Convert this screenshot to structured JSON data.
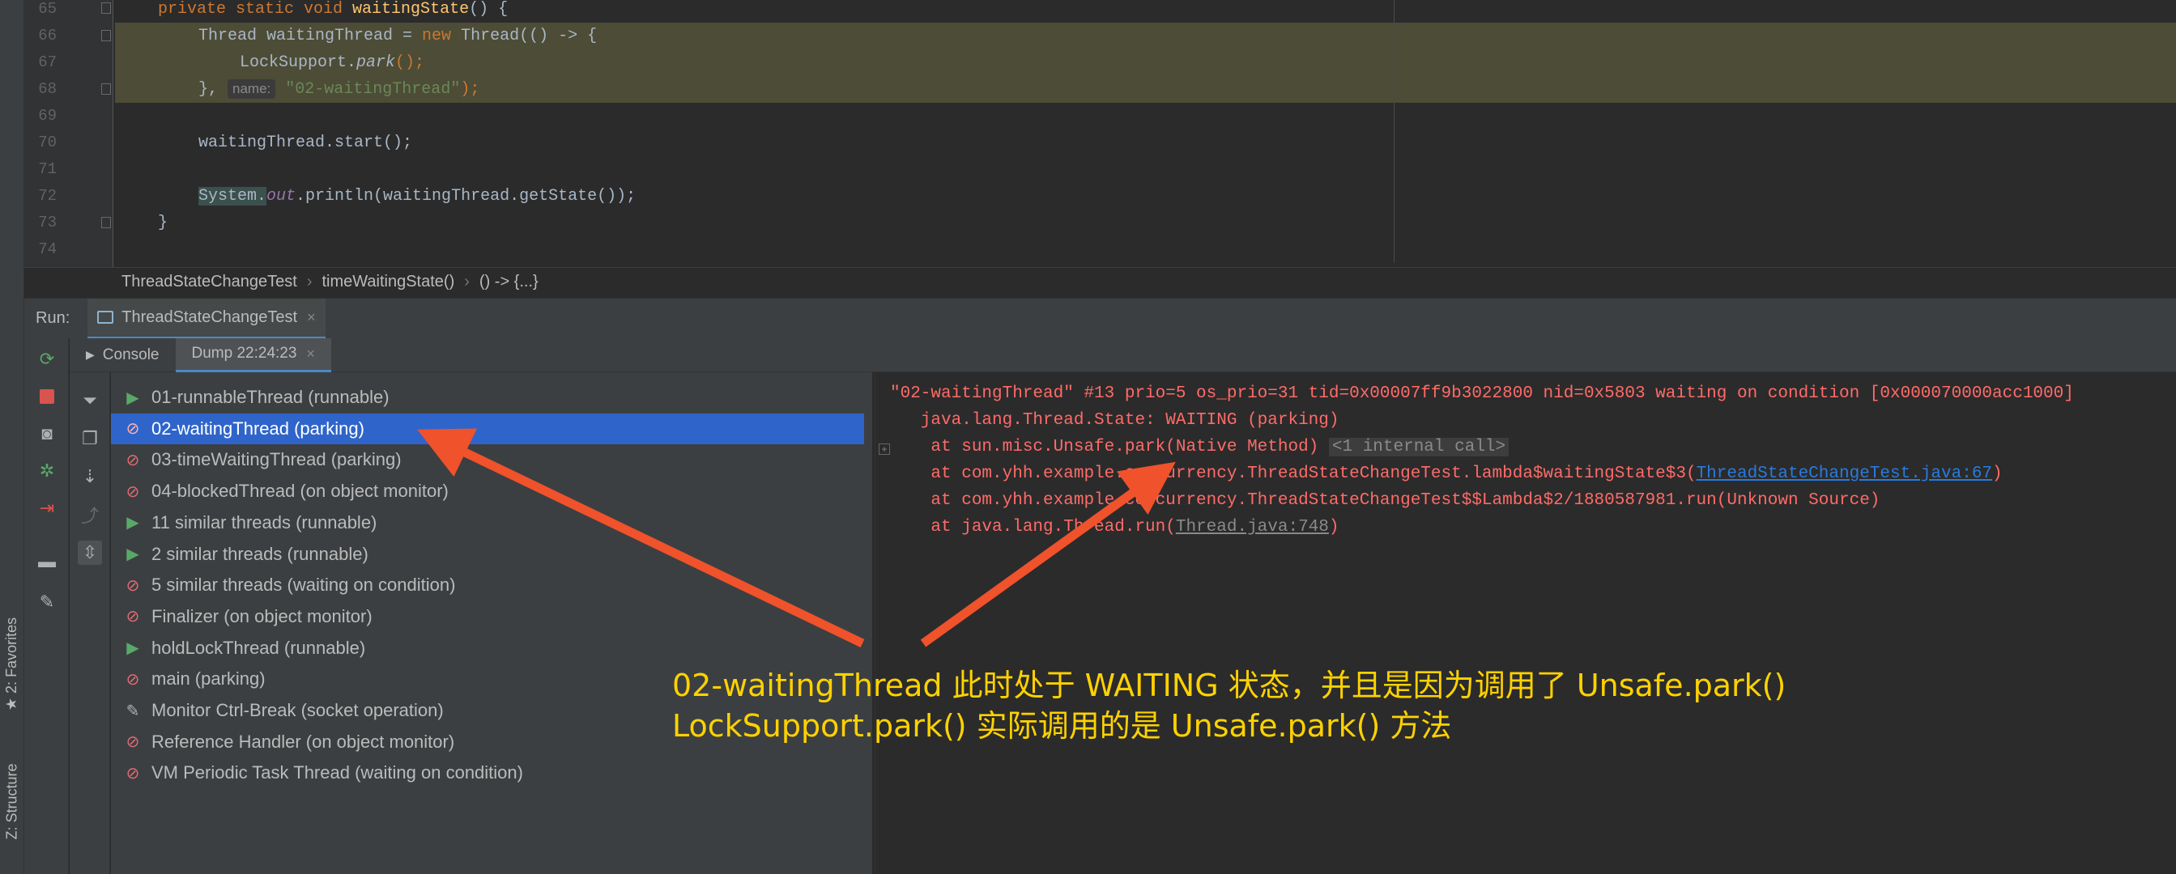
{
  "editor": {
    "lines": [
      {
        "num": "65"
      },
      {
        "num": "66"
      },
      {
        "num": "67"
      },
      {
        "num": "68"
      },
      {
        "num": "69"
      },
      {
        "num": "70"
      },
      {
        "num": "71"
      },
      {
        "num": "72"
      },
      {
        "num": "73"
      },
      {
        "num": "74"
      }
    ],
    "code": {
      "l65_kw": "private static void ",
      "l65_fn": "waitingState",
      "l65_rest": "() {",
      "l66_a": "Thread waitingThread = ",
      "l66_kw": "new ",
      "l66_b": "Thread(() -> {",
      "l67_a": "LockSupport.",
      "l67_it": "park",
      "l67_b": "();",
      "l68_a": "}, ",
      "l68_hint": "name:",
      "l68_str": "\"02-waitingThread\"",
      "l68_b": ");",
      "l70": "waitingThread.start();",
      "l72_a": "System.",
      "l72_fld": "out",
      "l72_b": ".println(waitingThread.getState());",
      "l73": "}"
    }
  },
  "breadcrumb": {
    "items": [
      "ThreadStateChangeTest",
      "timeWaitingState()",
      "() -> {...}"
    ],
    "separator": "›"
  },
  "run": {
    "label": "Run:",
    "tab_label": "ThreadStateChangeTest",
    "close": "×"
  },
  "sub_tabs": {
    "console": "Console",
    "dump": "Dump 22:24:23",
    "close": "×"
  },
  "threads": [
    {
      "label": "01-runnableThread (runnable)",
      "state": "runnable"
    },
    {
      "label": "02-waitingThread (parking)",
      "state": "parking"
    },
    {
      "label": "03-timeWaitingThread (parking)",
      "state": "parking"
    },
    {
      "label": "04-blockedThread (on object monitor)",
      "state": "parking"
    },
    {
      "label": "11 similar threads (runnable)",
      "state": "runnable"
    },
    {
      "label": "2 similar threads (runnable)",
      "state": "runnable"
    },
    {
      "label": "5 similar threads (waiting on condition)",
      "state": "parking"
    },
    {
      "label": "Finalizer (on object monitor)",
      "state": "parking"
    },
    {
      "label": "holdLockThread (runnable)",
      "state": "runnable"
    },
    {
      "label": "main (parking)",
      "state": "parking"
    },
    {
      "label": "Monitor Ctrl-Break (socket operation)",
      "state": "wrench"
    },
    {
      "label": "Reference Handler (on object monitor)",
      "state": "parking"
    },
    {
      "label": "VM Periodic Task Thread (waiting on condition)",
      "state": "parking"
    }
  ],
  "dump": {
    "line1": "\"02-waitingThread\" #13 prio=5 os_prio=31 tid=0x00007ff9b3022800 nid=0x5803 waiting on condition [0x000070000acc1000]",
    "line2": "   java.lang.Thread.State: WAITING (parking)",
    "line3_a": "    at sun.misc.Unsafe.park(Native Method) ",
    "line3_internal": "<1 internal call>",
    "line4_a": "    at com.yhh.example.concurrency.ThreadStateChangeTest.lambda$waitingState$3(",
    "line4_link": "ThreadStateChangeTest.java:67",
    "line4_b": ")",
    "line5": "    at com.yhh.example.concurrency.ThreadStateChangeTest$$Lambda$2/1880587981.run(Unknown Source)",
    "line6_a": "    at java.lang.Thread.run(",
    "line6_link": "Thread.java:748",
    "line6_b": ")"
  },
  "side_tabs": {
    "favorites": "★ 2: Favorites",
    "structure": "Z: Structure"
  },
  "annotation": {
    "line1": "02-waitingThread 此时处于 WAITING 状态，并且是因为调用了 Unsafe.park()",
    "line2": "LockSupport.park() 实际调用的是 Unsafe.park() 方法"
  },
  "colors": {
    "accent": "#2f65ca",
    "arrow": "#f0522b",
    "annotation": "#ffd200",
    "dump_text": "#ff6b68"
  }
}
